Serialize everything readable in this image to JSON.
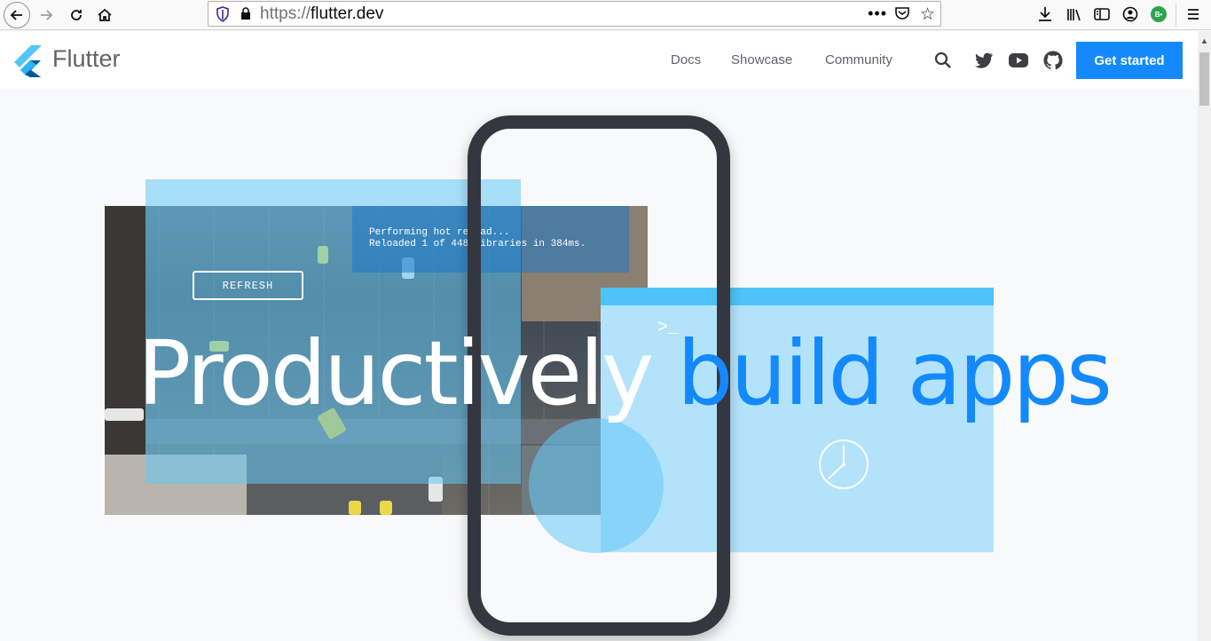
{
  "browser": {
    "url_protocol": "https://",
    "url_host": "flutter.dev",
    "profile_badge": "B•"
  },
  "site": {
    "logo_text": "Flutter",
    "nav": {
      "docs": "Docs",
      "showcase": "Showcase",
      "community": "Community"
    },
    "cta_label": "Get started"
  },
  "hero": {
    "console_line1": "Performing hot reload...",
    "console_line2": "Reloaded 1 of 448 libraries in 384ms.",
    "refresh_label": "REFRESH",
    "prompt": ">_",
    "title_word1": "Productively",
    "title_word2": "build apps"
  },
  "colors": {
    "accent": "#1389fd",
    "phone_frame": "#343640",
    "light_blue": "#b3e3fb"
  }
}
